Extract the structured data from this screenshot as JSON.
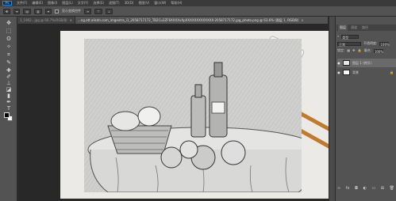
{
  "app": {
    "logo": "Ps"
  },
  "menubar": {
    "items": [
      "文件(F)",
      "编辑(E)",
      "图像(I)",
      "图层(L)",
      "文字(Y)",
      "选择(S)",
      "滤镜(T)",
      "3D(D)",
      "视图(V)",
      "窗口(W)",
      "帮助(H)"
    ]
  },
  "options": {
    "checkbox_label": "显示变换控件"
  },
  "tabs": [
    {
      "label": "1_1902...jpg @ 66.7%(RGB/8)",
      "active": false
    },
    {
      "label": "...ng.att.alicdn.com_imgextra_i1_2058717172_TB2Cu3ZF6XXXXvXpXXXXXXXXXXXXX-2058717172.jpg_photo.png @ 63.6% (图层 1, RGB/8)",
      "active": true
    }
  ],
  "panels": {
    "tabs": [
      "图层",
      "通道",
      "路径"
    ],
    "filter_label": "类型",
    "blend_mode": "正常",
    "opacity_label": "不透明度:",
    "opacity_value": "100%",
    "lock_label": "锁定:",
    "fill_label": "填充:",
    "fill_value": "100%",
    "layers": [
      {
        "name": "图层 1 (拷贝)",
        "selected": true
      },
      {
        "name": "背景",
        "selected": false
      }
    ]
  },
  "colors": {
    "foreground": "#000000",
    "background": "#ffffff",
    "accent": "#31a8ff"
  }
}
